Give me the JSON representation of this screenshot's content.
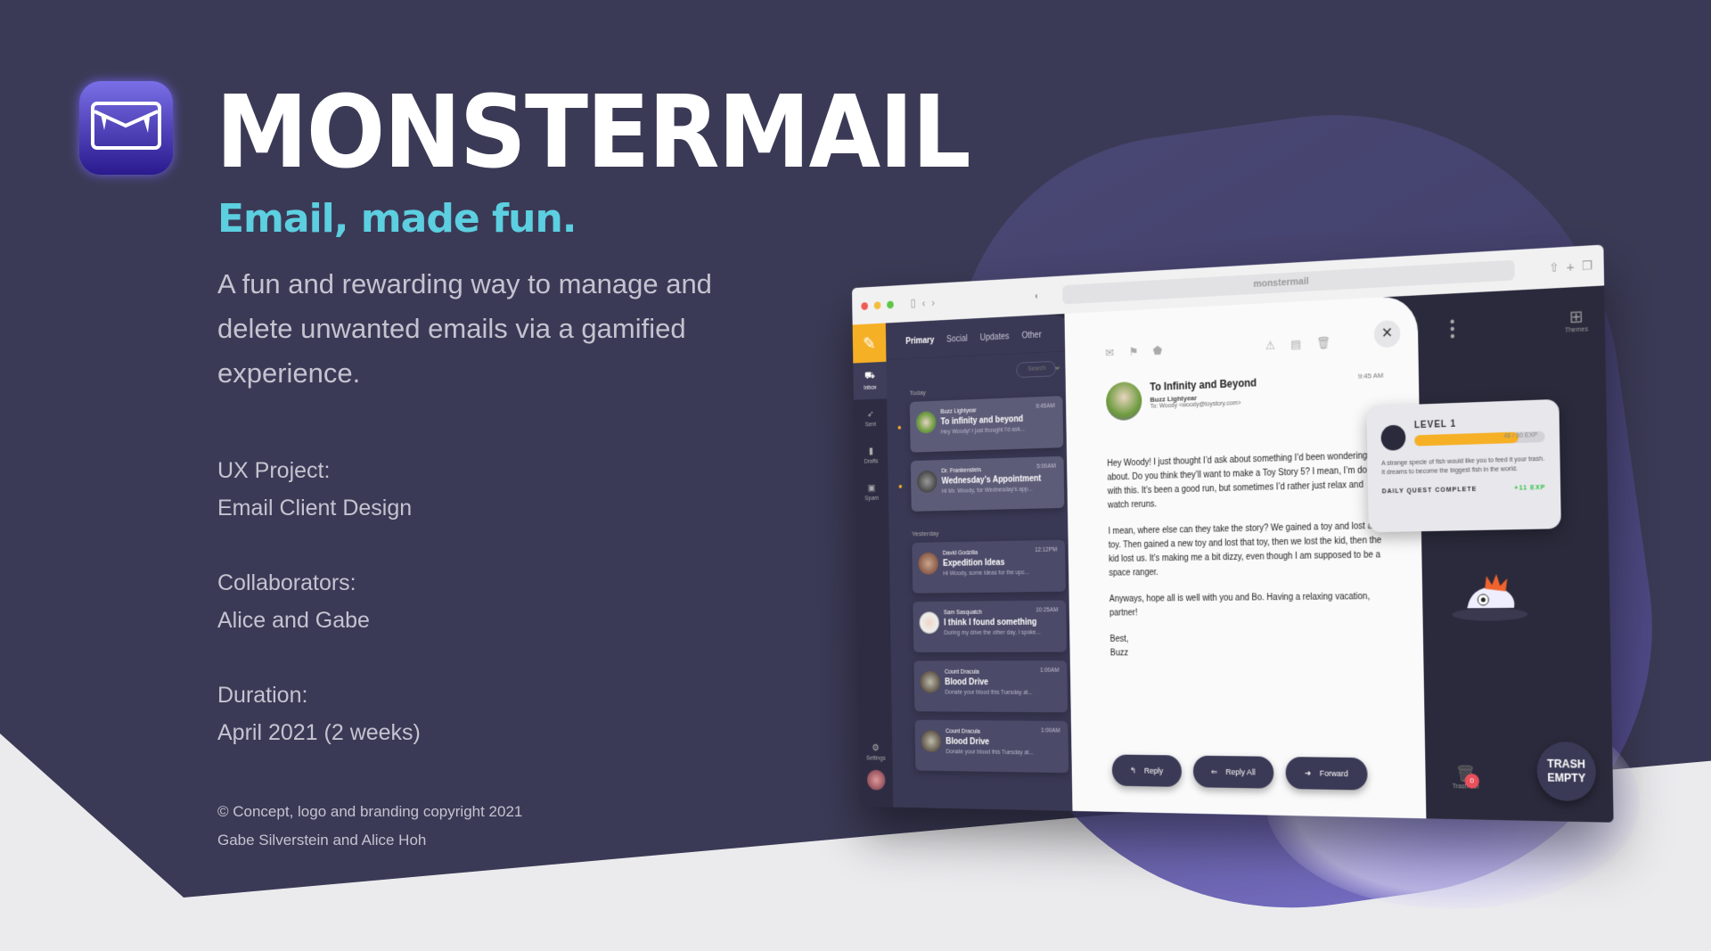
{
  "brand": {
    "name": "MONSTERMAIL",
    "tagline": "Email, made fun.",
    "description": "A fun and rewarding way to manage and delete unwanted emails via a gamified experience.",
    "accent": "#5ccfe0",
    "background": "#3b3a56"
  },
  "project": [
    {
      "label": "UX Project:",
      "value": "Email Client Design"
    },
    {
      "label": "Collaborators:",
      "value": "Alice and Gabe"
    },
    {
      "label": "Duration:",
      "value": "April 2021 (2 weeks)"
    }
  ],
  "copyright": {
    "line1": "© Concept, logo and branding copyright 2021",
    "line2": "Gabe Silverstein and Alice Hoh"
  },
  "browser": {
    "url": "monstermail"
  },
  "nav": {
    "items": [
      {
        "label": "Inbox",
        "icon": "inbox-icon"
      },
      {
        "label": "Sent",
        "icon": "rocket-icon"
      },
      {
        "label": "Drafts",
        "icon": "document-icon"
      },
      {
        "label": "Spam",
        "icon": "spam-icon"
      }
    ],
    "settings": "Settings"
  },
  "tabs": [
    "Primary",
    "Social",
    "Updates",
    "Other"
  ],
  "search": {
    "placeholder": "Search"
  },
  "groups": [
    {
      "label": "Today",
      "emails": [
        {
          "from": "Buzz Lightyear",
          "subject": "To infinity and beyond",
          "preview": "Hey Woody! I just thought I'd ask...",
          "time": "9:45AM",
          "unread": true
        },
        {
          "from": "Dr. Frankenstein",
          "subject": "Wednesday's Appointment",
          "preview": "Hi Mr. Woody, for Wednesday's app...",
          "time": "5:00AM",
          "unread": true
        }
      ]
    },
    {
      "label": "Yesterday",
      "emails": [
        {
          "from": "David Godzilla",
          "subject": "Expedition Ideas",
          "preview": "Hi Woody, some ideas for the upc...",
          "time": "12:12PM"
        },
        {
          "from": "Sam Sasquatch",
          "subject": "I think I found something",
          "preview": "During my drive the other day, I spoke...",
          "time": "10:25AM"
        },
        {
          "from": "Count Dracula",
          "subject": "Blood Drive",
          "preview": "Donate your blood this Tuesday at...",
          "time": "1:00AM"
        },
        {
          "from": "Count Dracula",
          "subject": "Blood Drive",
          "preview": "Donate your blood this Tuesday at...",
          "time": "1:00AM"
        }
      ]
    }
  ],
  "message": {
    "subject": "To Infinity and Beyond",
    "sender": "Buzz Lightyear",
    "to": "To: Woody  <woody@toystory.com>",
    "time": "9:45 AM",
    "body": [
      "Hey Woody! I just thought I’d ask about something I’d been wondering about. Do you think they’ll want to make a Toy Story 5? I mean, I’m done with this. It’s been a good run, but sometimes I’d rather just relax and watch reruns.",
      "I mean, where else can they take the story? We gained a toy and lost a toy. Then gained a new toy and lost that toy, then we lost the kid, then the kid lost us. It’s making me a bit dizzy, even though I am supposed to be a space ranger.",
      "Anyways, hope all is well with you and Bo. Having a relaxing vacation, partner!"
    ],
    "signoff": "Best,",
    "signature": "Buzz",
    "actions": {
      "reply": "Reply",
      "reply_all": "Reply All",
      "forward": "Forward"
    }
  },
  "level": {
    "title": "LEVEL 1",
    "exp": 48,
    "max_exp": 60,
    "exp_text": "48 / 60 EXP",
    "description": "A strange specie of fish would like you to feed it your trash. It dreams to become the biggest fish in the world.",
    "quest": "DAILY QUEST COMPLETE",
    "reward": "+11 EXP"
  },
  "side": {
    "themes": "Themes",
    "trash_label": "Trash Bin",
    "trash_count": "0",
    "trash_status": "TRASH EMPTY"
  }
}
